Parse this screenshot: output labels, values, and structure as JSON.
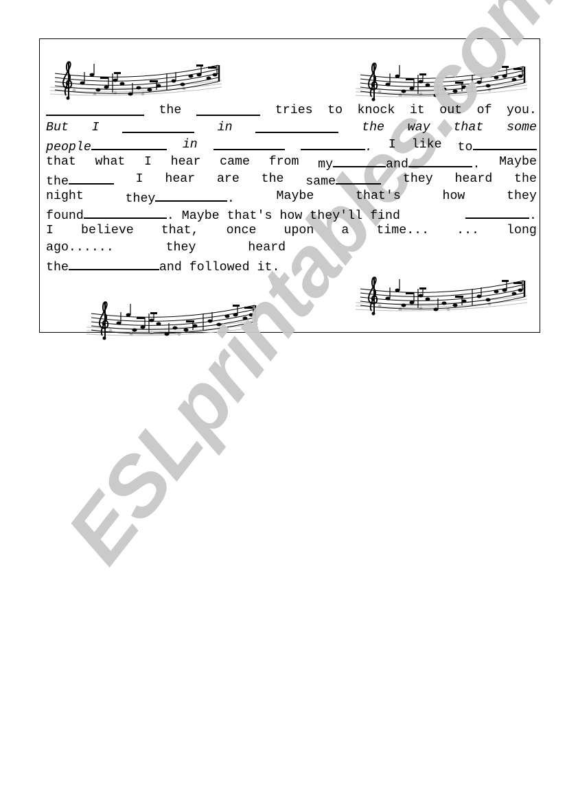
{
  "worksheet": {
    "lines": [
      {
        "parts": [
          {
            "blank": 1
          },
          {
            "t": "the"
          },
          {
            "blank": 2
          },
          {
            "t": "tries"
          },
          {
            "t": "to"
          },
          {
            "t": "knock"
          },
          {
            "t": "it"
          },
          {
            "t": "out"
          },
          {
            "t": "of"
          },
          {
            "t": "you."
          }
        ]
      },
      {
        "parts": [
          {
            "t": "But",
            "i": true
          },
          {
            "t": "I",
            "i": true
          },
          {
            "blank": 3
          },
          {
            "t": "in",
            "i": true
          },
          {
            "blank": 4
          },
          {
            "t": "the",
            "i": true
          },
          {
            "t": "way",
            "i": true
          },
          {
            "t": "that",
            "i": true
          },
          {
            "t": "some",
            "i": true
          }
        ]
      },
      {
        "parts": [
          {
            "t": "people",
            "i": true,
            "blank": 5
          },
          {
            "t": "in",
            "i": true
          },
          {
            "blank": 6
          },
          {
            "blank": 7,
            "after": ".",
            "after_i": true
          },
          {
            "t": "I"
          },
          {
            "t": "like"
          },
          {
            "t": "to",
            "blank": 8
          }
        ]
      },
      {
        "parts": [
          {
            "t": "that"
          },
          {
            "t": "what"
          },
          {
            "t": "I"
          },
          {
            "t": "hear"
          },
          {
            "t": "came"
          },
          {
            "t": "from"
          },
          {
            "t": "my",
            "blank": 9,
            "after": "and",
            "blank2": 10,
            "after2": "."
          },
          {
            "t": "Maybe"
          }
        ]
      },
      {
        "parts": [
          {
            "t": "the",
            "blank": 11
          },
          {
            "t": "I"
          },
          {
            "t": "hear"
          },
          {
            "t": "are"
          },
          {
            "t": "the"
          },
          {
            "t": "same",
            "blank": 12
          },
          {
            "t": "they"
          },
          {
            "t": "heard"
          },
          {
            "t": "the"
          }
        ]
      },
      {
        "parts": [
          {
            "t": "night"
          },
          {
            "t": "they",
            "blank": 13,
            "after": "."
          },
          {
            "t": "Maybe"
          },
          {
            "t": "that's"
          },
          {
            "t": "how"
          },
          {
            "t": "they"
          }
        ]
      },
      {
        "parts": [
          {
            "t": "found",
            "blank": 14,
            "after": ". Maybe that's how they'll find"
          },
          {
            "blank": 15,
            "after": "."
          }
        ]
      },
      {
        "parts": [
          {
            "t": "I"
          },
          {
            "t": "believe"
          },
          {
            "t": "that,"
          },
          {
            "t": "once"
          },
          {
            "t": "upon"
          },
          {
            "t": "a"
          },
          {
            "t": "time..."
          },
          {
            "t": "..."
          },
          {
            "t": "long"
          }
        ]
      },
      {
        "left": true,
        "parts": [
          {
            "t": "ago......"
          },
          {
            "t": "      they"
          },
          {
            "t": "      heard"
          }
        ]
      },
      {
        "left": true,
        "parts": [
          {
            "t": "the",
            "blank": 16,
            "after": "and followed it."
          }
        ]
      }
    ]
  },
  "blank_widths_ch": {
    "1": 13,
    "2": 8.5,
    "3": 9.5,
    "4": 11,
    "5": 10,
    "6": 9.5,
    "7": 8.5,
    "8": 8.5,
    "9": 7,
    "10": 8.5,
    "11": 6,
    "12": 6,
    "13": 9.5,
    "14": 11,
    "15": 8.5,
    "16": 12
  },
  "decorations": {
    "music_staff_icons": [
      "music-staff-top-left",
      "music-staff-top-right",
      "music-staff-bottom-right",
      "music-staff-bottom-left"
    ]
  },
  "watermark": {
    "text": "ESLprintables.com"
  }
}
